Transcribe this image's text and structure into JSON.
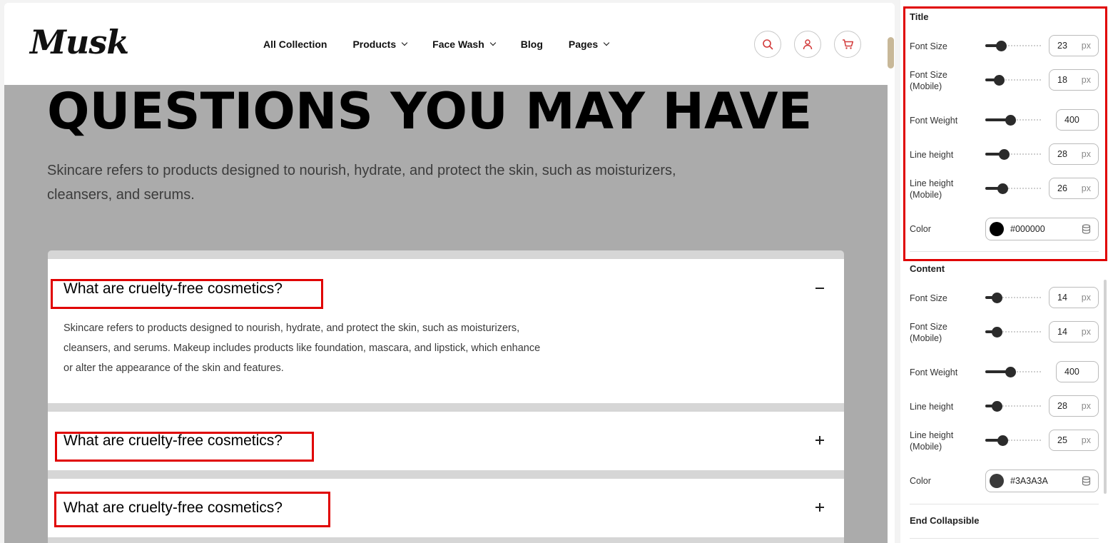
{
  "header": {
    "logo": "Musk",
    "nav": [
      {
        "label": "All Collection",
        "dropdown": false
      },
      {
        "label": "Products",
        "dropdown": true
      },
      {
        "label": "Face Wash",
        "dropdown": true
      },
      {
        "label": "Blog",
        "dropdown": false
      },
      {
        "label": "Pages",
        "dropdown": true
      }
    ],
    "icons": [
      "search-icon",
      "user-icon",
      "cart-icon"
    ],
    "icon_color": "#d23a3a"
  },
  "hero": {
    "title": "QUESTIONS YOU MAY HAVE",
    "description": "Skincare refers to products designed to nourish, hydrate, and protect the skin, such as moisturizers, cleansers, and serums."
  },
  "faq": [
    {
      "question": "What are cruelty-free cosmetics?",
      "answer": "Skincare refers to products designed to nourish, hydrate, and protect the skin, such as moisturizers, cleansers, and serums. Makeup includes products like foundation, mascara, and lipstick, which enhance or alter the appearance of the skin and features.",
      "expanded": true
    },
    {
      "question": "What are cruelty-free cosmetics?",
      "expanded": false
    },
    {
      "question": "What are cruelty-free cosmetics?",
      "expanded": false
    }
  ],
  "panel": {
    "title_section": {
      "heading": "Title",
      "font_size": {
        "label": "Font Size",
        "value": "23",
        "unit": "px",
        "level": 0.28
      },
      "font_size_mobile": {
        "label": "Font Size (Mobile)",
        "value": "18",
        "unit": "px",
        "level": 0.24
      },
      "font_weight": {
        "label": "Font Weight",
        "value": "400",
        "level": 0.44
      },
      "line_height": {
        "label": "Line height",
        "value": "28",
        "unit": "px",
        "level": 0.32
      },
      "line_height_mobile": {
        "label": "Line height (Mobile)",
        "value": "26",
        "unit": "px",
        "level": 0.3
      },
      "color": {
        "label": "Color",
        "value": "#000000"
      }
    },
    "content_section": {
      "heading": "Content",
      "font_size": {
        "label": "Font Size",
        "value": "14",
        "unit": "px",
        "level": 0.2
      },
      "font_size_mobile": {
        "label": "Font Size (Mobile)",
        "value": "14",
        "unit": "px",
        "level": 0.2
      },
      "font_weight": {
        "label": "Font Weight",
        "value": "400",
        "level": 0.44
      },
      "line_height": {
        "label": "Line height",
        "value": "28",
        "unit": "px",
        "level": 0.2
      },
      "line_height_mobile": {
        "label": "Line height (Mobile)",
        "value": "25",
        "unit": "px",
        "level": 0.3
      },
      "color": {
        "label": "Color",
        "value": "#3A3A3A"
      }
    },
    "end_collapsible": "End Collapsible"
  }
}
